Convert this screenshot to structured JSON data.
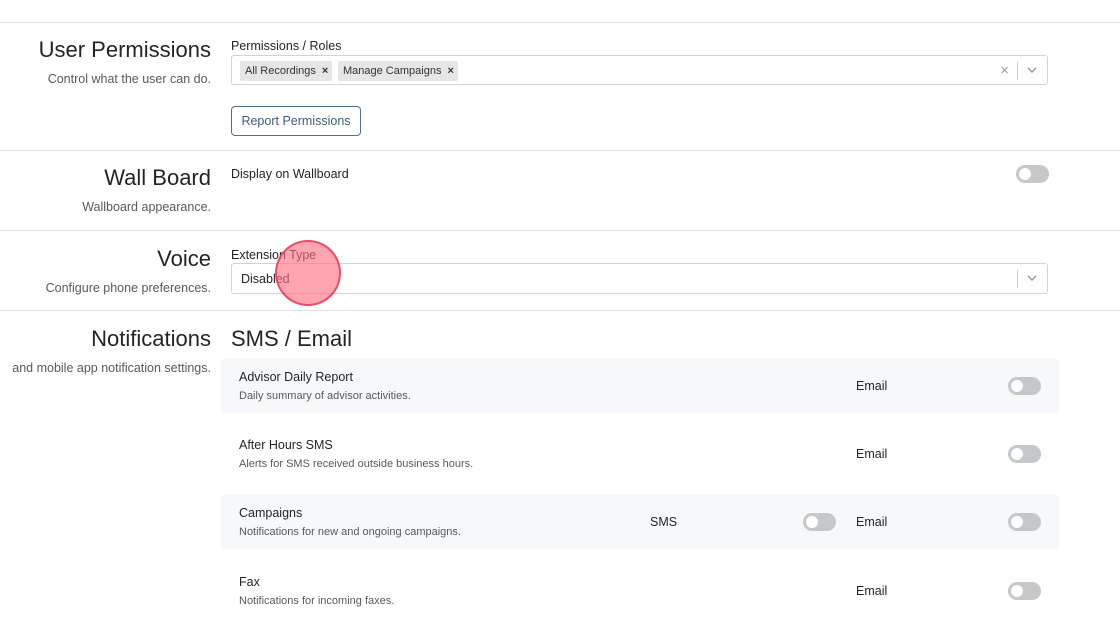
{
  "user_permissions": {
    "title": "User Permissions",
    "description": "Control what the user can do.",
    "field_label": "Permissions / Roles",
    "selected": [
      {
        "label": "All Recordings",
        "remove": "×"
      },
      {
        "label": "Manage Campaigns",
        "remove": "×"
      }
    ],
    "clear_label": "×",
    "button_label": "Report Permissions"
  },
  "wall_board": {
    "title": "Wall Board",
    "description": "Wallboard appearance.",
    "toggle_label": "Display on Wallboard",
    "enabled": false
  },
  "voice": {
    "title": "Voice",
    "description": "Configure phone preferences.",
    "field_label": "Extension Type",
    "value": "Disabled"
  },
  "notifications": {
    "title": "Notifications",
    "description": "and mobile app notification settings.",
    "heading": "SMS / Email",
    "items": [
      {
        "title": "Advisor Daily Report",
        "description": "Daily summary of advisor activities.",
        "email_label": "Email",
        "email_enabled": false
      },
      {
        "title": "After Hours SMS",
        "description": "Alerts for SMS received outside business hours.",
        "email_label": "Email",
        "email_enabled": false
      },
      {
        "title": "Campaigns",
        "description": "Notifications for new and ongoing campaigns.",
        "sms_label": "SMS",
        "sms_enabled": false,
        "email_label": "Email",
        "email_enabled": false
      },
      {
        "title": "Fax",
        "description": "Notifications for incoming faxes.",
        "email_label": "Email",
        "email_enabled": false
      }
    ]
  },
  "colors": {
    "toggle_off": "#c6c7c8",
    "outline_button": "#4f6f8f",
    "row_alt_bg": "#f7f8f9",
    "divider": "#dee2e6",
    "click_marker": "#ff6e82"
  }
}
